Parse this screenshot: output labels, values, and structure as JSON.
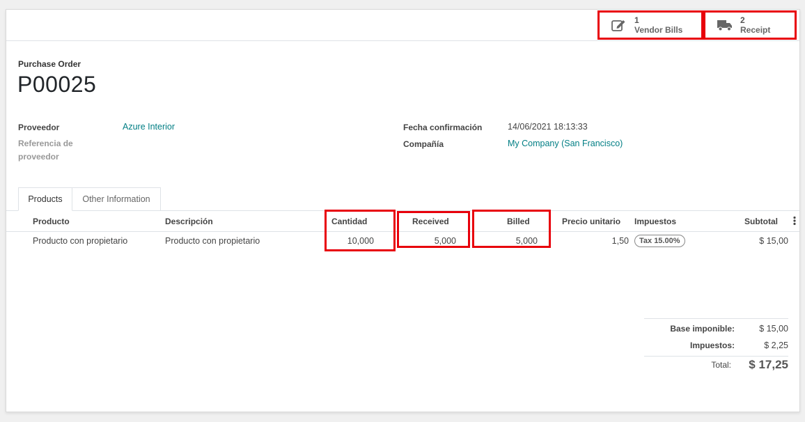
{
  "smart_buttons": {
    "vendor_bills": {
      "count": "1",
      "label": "Vendor Bills"
    },
    "receipt": {
      "count": "2",
      "label": "Receipt"
    }
  },
  "header": {
    "doc_type": "Purchase Order",
    "doc_name": "P00025"
  },
  "fields": {
    "vendor_label": "Proveedor",
    "vendor_value": "Azure Interior",
    "vendor_ref_label": "Referencia de proveedor",
    "confirm_date_label": "Fecha confirmación",
    "confirm_date_value": "14/06/2021 18:13:33",
    "company_label": "Compañía",
    "company_value": "My Company (San Francisco)"
  },
  "tabs": [
    {
      "label": "Products",
      "active": true
    },
    {
      "label": "Other Information",
      "active": false
    }
  ],
  "table": {
    "columns": [
      "Producto",
      "Descripción",
      "Cantidad",
      "Received",
      "Billed",
      "Precio unitario",
      "Impuestos",
      "Subtotal"
    ],
    "rows": [
      {
        "product": "Producto con propietario",
        "description": "Producto con propietario",
        "quantity": "10,000",
        "received": "5,000",
        "billed": "5,000",
        "unit_price": "1,50",
        "taxes": "Tax 15.00%",
        "subtotal": "$ 15,00"
      }
    ]
  },
  "totals": {
    "untaxed_label": "Base imponible:",
    "untaxed_value": "$ 15,00",
    "taxes_label": "Impuestos:",
    "taxes_value": "$ 2,25",
    "total_label": "Total:",
    "total_value": "$ 17,25"
  },
  "colors": {
    "highlight": "#e8000b",
    "link": "#017e84"
  }
}
